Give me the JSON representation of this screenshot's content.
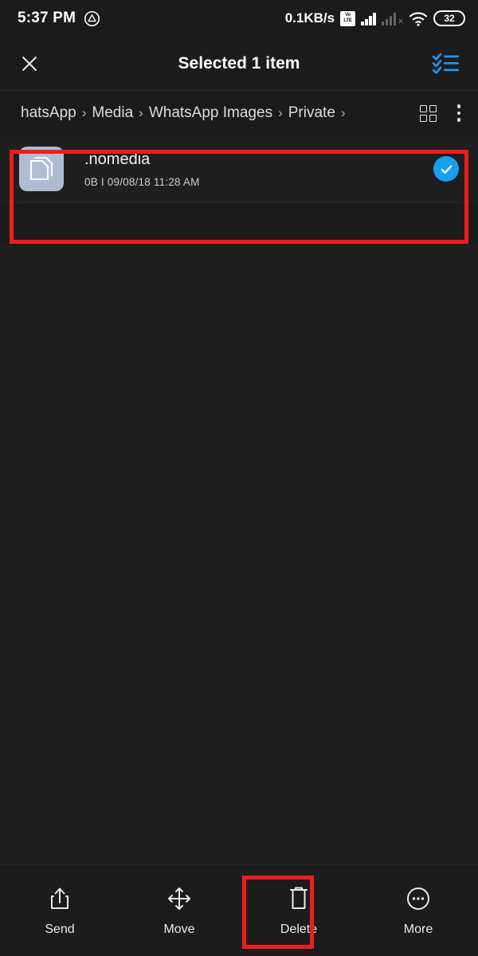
{
  "status_bar": {
    "time": "5:37 PM",
    "app_icon": "triangle-circle-icon",
    "data_rate": "0.1KB/s",
    "volte_top": "Vo",
    "volte_bottom": "LTE",
    "sim1_icon": "signal-bars-full-icon",
    "sim2_icon": "signal-bars-no-service-icon",
    "sim2_mark": "×",
    "wifi_icon": "wifi-icon",
    "battery_level": "32"
  },
  "app_bar": {
    "close_icon": "close-icon",
    "title": "Selected 1 item",
    "select_all_icon": "select-all-checklist-icon"
  },
  "breadcrumb": {
    "items": [
      {
        "label": "hatsApp"
      },
      {
        "label": "Media"
      },
      {
        "label": "WhatsApp Images"
      },
      {
        "label": "Private"
      }
    ],
    "separator": "›",
    "grid_view_icon": "grid-view-icon",
    "overflow_menu_icon": "more-vertical-icon"
  },
  "file_list": {
    "rows": [
      {
        "icon": "document-copy-icon",
        "name": ".nomedia",
        "size": "0B",
        "meta_separator": "I",
        "date": "09/08/18 11:28 AM",
        "selected": true,
        "check_icon": "checkmark-icon"
      }
    ]
  },
  "bottom_bar": {
    "actions": [
      {
        "icon": "share-upload-icon",
        "label": "Send"
      },
      {
        "icon": "move-arrows-icon",
        "label": "Move"
      },
      {
        "icon": "trash-delete-icon",
        "label": "Delete"
      },
      {
        "icon": "more-circle-icon",
        "label": "More"
      }
    ]
  },
  "annotations": {
    "highlight_color": "#ee1d1d",
    "boxes": [
      {
        "name": "selected-file-row-highlight"
      },
      {
        "name": "delete-button-highlight"
      }
    ]
  },
  "colors": {
    "accent_blue": "#189ff0",
    "background": "#1b1b1b",
    "list_background": "#1f1f1f",
    "file_icon_bg": "#aebdd1"
  }
}
